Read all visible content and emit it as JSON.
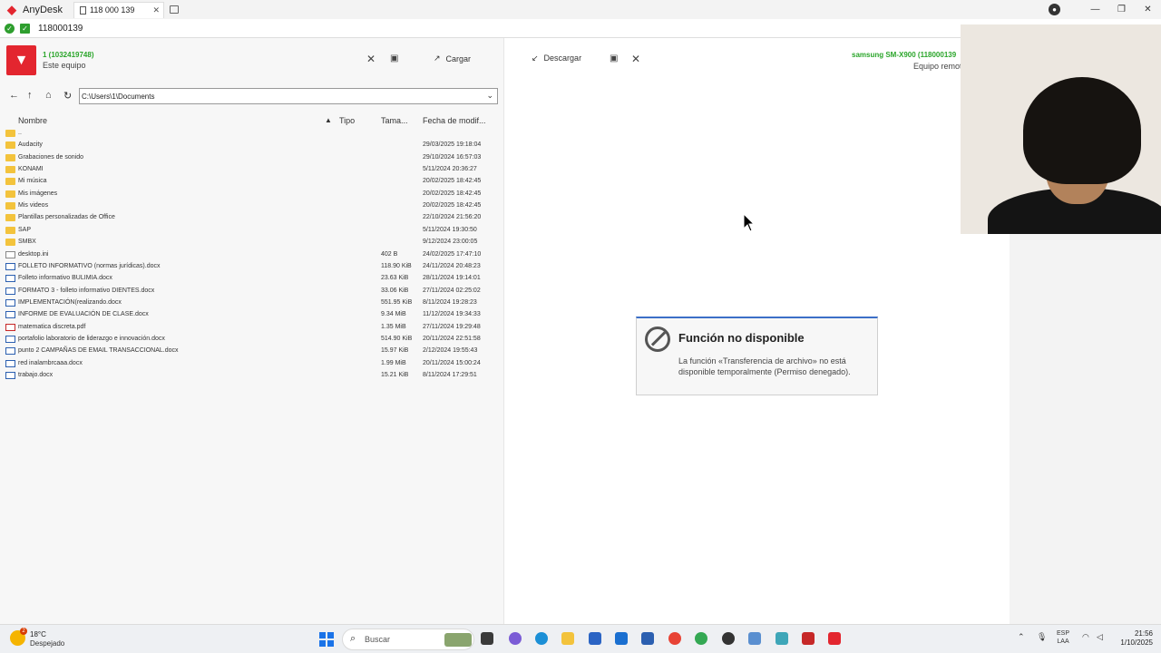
{
  "titlebar": {
    "app_name": "AnyDesk",
    "tab_label": "118 000 139"
  },
  "addressbar": {
    "value": "118000139"
  },
  "local": {
    "id": "1 (1032419748)",
    "label": "Este equipo",
    "upload_label": "Cargar",
    "path": "C:\\Users\\1\\Documents",
    "columns": {
      "name": "Nombre",
      "type": "Tipo",
      "size": "Tama...",
      "date": "Fecha de modif..."
    },
    "files": [
      {
        "name": "..",
        "size": "",
        "date": "",
        "kind": "folder"
      },
      {
        "name": "Audacity",
        "size": "",
        "date": "29/03/2025 19:18:04",
        "kind": "folder"
      },
      {
        "name": "Grabaciones de sonido",
        "size": "",
        "date": "29/10/2024 16:57:03",
        "kind": "folder"
      },
      {
        "name": "KONAMI",
        "size": "",
        "date": "5/11/2024 20:36:27",
        "kind": "folder"
      },
      {
        "name": "Mi música",
        "size": "",
        "date": "20/02/2025 18:42:45",
        "kind": "folder"
      },
      {
        "name": "Mis imágenes",
        "size": "",
        "date": "20/02/2025 18:42:45",
        "kind": "folder"
      },
      {
        "name": "Mis videos",
        "size": "",
        "date": "20/02/2025 18:42:45",
        "kind": "folder"
      },
      {
        "name": "Plantillas personalizadas de Office",
        "size": "",
        "date": "22/10/2024 21:56:20",
        "kind": "folder"
      },
      {
        "name": "SAP",
        "size": "",
        "date": "5/11/2024 19:30:50",
        "kind": "folder"
      },
      {
        "name": "SMBX",
        "size": "",
        "date": "9/12/2024 23:00:05",
        "kind": "folder"
      },
      {
        "name": "desktop.ini",
        "size": "402 B",
        "date": "24/02/2025 17:47:10",
        "kind": "ini"
      },
      {
        "name": "FOLLETO INFORMATIVO (normas jurídicas).docx",
        "size": "118.90 KiB",
        "date": "24/11/2024 20:48:23",
        "kind": "doc"
      },
      {
        "name": "Folleto informativo BULIMIA.docx",
        "size": "23.63 KiB",
        "date": "28/11/2024 19:14:01",
        "kind": "doc"
      },
      {
        "name": "FORMATO 3 - folleto informativo DIENTES.docx",
        "size": "33.06 KiB",
        "date": "27/11/2024 02:25:02",
        "kind": "doc"
      },
      {
        "name": "IMPLEMENTACIÓN(realizando.docx",
        "size": "551.95 KiB",
        "date": "8/11/2024 19:28:23",
        "kind": "doc"
      },
      {
        "name": "INFORME DE EVALUACIÓN DE CLASE.docx",
        "size": "9.34 MiB",
        "date": "11/12/2024 19:34:33",
        "kind": "doc"
      },
      {
        "name": "matematica discreta.pdf",
        "size": "1.35 MiB",
        "date": "27/11/2024 19:29:48",
        "kind": "pdf"
      },
      {
        "name": "portafolio laboratorio de liderazgo e innovación.docx",
        "size": "514.90 KiB",
        "date": "20/11/2024 22:51:58",
        "kind": "doc"
      },
      {
        "name": "punto 2 CAMPAÑAS DE EMAIL TRANSACCIONAL.docx",
        "size": "15.97 KiB",
        "date": "2/12/2024 19:55:43",
        "kind": "doc"
      },
      {
        "name": "red inalambrcaaa.docx",
        "size": "1.99 MiB",
        "date": "20/11/2024 15:00:24",
        "kind": "doc"
      },
      {
        "name": "trabajo.docx",
        "size": "15.21 KiB",
        "date": "8/11/2024 17:29:51",
        "kind": "doc"
      }
    ]
  },
  "remote": {
    "download_label": "Descargar",
    "device": "samsung SM-X900 (118000139",
    "label": "Equipo remoto"
  },
  "dialog": {
    "title": "Función no disponible",
    "message": "La función «Transferencia de archivo» no está disponible temporalmente (Permiso denegado)."
  },
  "taskbar": {
    "weather_temp": "18°C",
    "weather_desc": "Despejado",
    "search_placeholder": "Buscar",
    "lang_1": "ESP",
    "lang_2": "LAA",
    "time": "21:56",
    "date": "1/10/2025"
  },
  "colors": {
    "brand": "#e3262f",
    "connected": "#2aa52a",
    "accent": "#3c6fc8"
  }
}
